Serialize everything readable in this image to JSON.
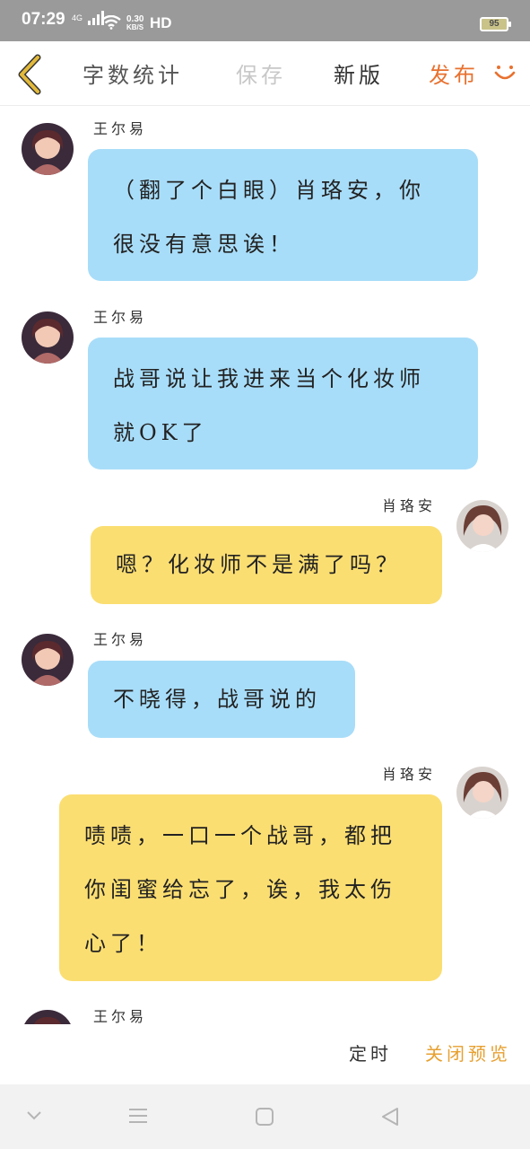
{
  "status_bar": {
    "time": "07:29",
    "network": "4G",
    "speed_value": "0.30",
    "speed_unit": "KB/S",
    "hd": "HD",
    "battery": "95"
  },
  "toolbar": {
    "word_count": "字数统计",
    "save": "保存",
    "new_version": "新版",
    "publish": "发布"
  },
  "messages": [
    {
      "sender": "王尔易",
      "side": "left",
      "color": "blue",
      "lines": [
        "（翻了个白眼）肖珞安，你",
        "很没有意思诶！"
      ]
    },
    {
      "sender": "王尔易",
      "side": "left",
      "color": "blue",
      "lines": [
        "战哥说让我进来当个化妆师",
        "就OK了"
      ]
    },
    {
      "sender": "肖珞安",
      "side": "right",
      "color": "yellow",
      "lines": [
        "嗯？化妆师不是满了吗？"
      ]
    },
    {
      "sender": "王尔易",
      "side": "left",
      "color": "blue",
      "lines": [
        "不晓得，战哥说的"
      ]
    },
    {
      "sender": "肖珞安",
      "side": "right",
      "color": "yellow",
      "lines": [
        "啧啧，一口一个战哥，都把",
        "你闺蜜给忘了，诶，我太伤",
        "心了！"
      ]
    },
    {
      "sender": "王尔易",
      "side": "left",
      "color": "blue",
      "lines": []
    }
  ],
  "bottom": {
    "timer": "定时",
    "close_preview": "关闭预览"
  },
  "colors": {
    "blue_bubble": "#a8ddf9",
    "yellow_bubble": "#fbde72",
    "publish": "#e8712f",
    "close_preview": "#e7a030",
    "back_arrow": "#e2b93b"
  }
}
